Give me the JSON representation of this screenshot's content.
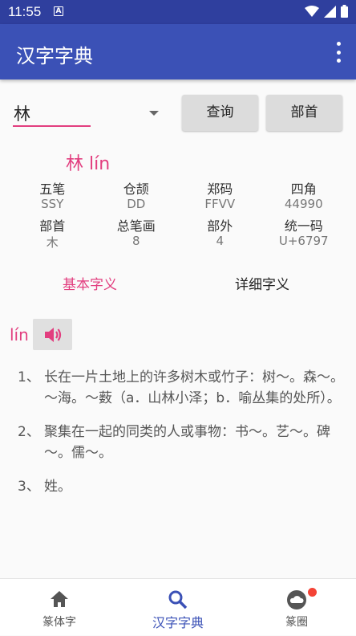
{
  "status_bar": {
    "time": "11:55",
    "notification_icon": "a-box-icon",
    "icons": [
      "wifi-icon",
      "signal-icon",
      "battery-icon"
    ]
  },
  "app_bar": {
    "title": "汉字字典",
    "menu_icon": "more-vert-icon"
  },
  "search": {
    "value": "林"
  },
  "buttons": {
    "query": "查询",
    "radical": "部首"
  },
  "character": {
    "title": "林 lín"
  },
  "info": {
    "headers1": [
      "五笔",
      "仓颉",
      "郑码",
      "四角"
    ],
    "values1": [
      "SSY",
      "DD",
      "FFVV",
      "44990"
    ],
    "headers2": [
      "部首",
      "总笔画",
      "部外",
      "统一码"
    ],
    "values2": [
      "木",
      "8",
      "4",
      "U+6797"
    ]
  },
  "tabs": {
    "basic": "基本字义",
    "detail": "详细字义"
  },
  "pronunciation": {
    "pinyin": "lín",
    "icon": "speaker-icon"
  },
  "definitions": [
    {
      "num": "1、",
      "text": "长在一片土地上的许多树木或竹子：树～。森～。～海。～薮（a．山林小泽；b．喻丛集的处所）。"
    },
    {
      "num": "2、",
      "text": "聚集在一起的同类的人或事物：书～。艺～。碑～。儒～。"
    },
    {
      "num": "3、",
      "text": "姓。"
    }
  ],
  "bottom_nav": [
    {
      "label": "篆体字",
      "icon": "home-icon"
    },
    {
      "label": "汉字字典",
      "icon": "search-icon"
    },
    {
      "label": "篆圈",
      "icon": "cloud-icon"
    }
  ],
  "colors": {
    "primary": "#3b51b6",
    "status_bar": "#2f3f9e",
    "accent": "#e23e7f",
    "badge": "#f44336"
  }
}
